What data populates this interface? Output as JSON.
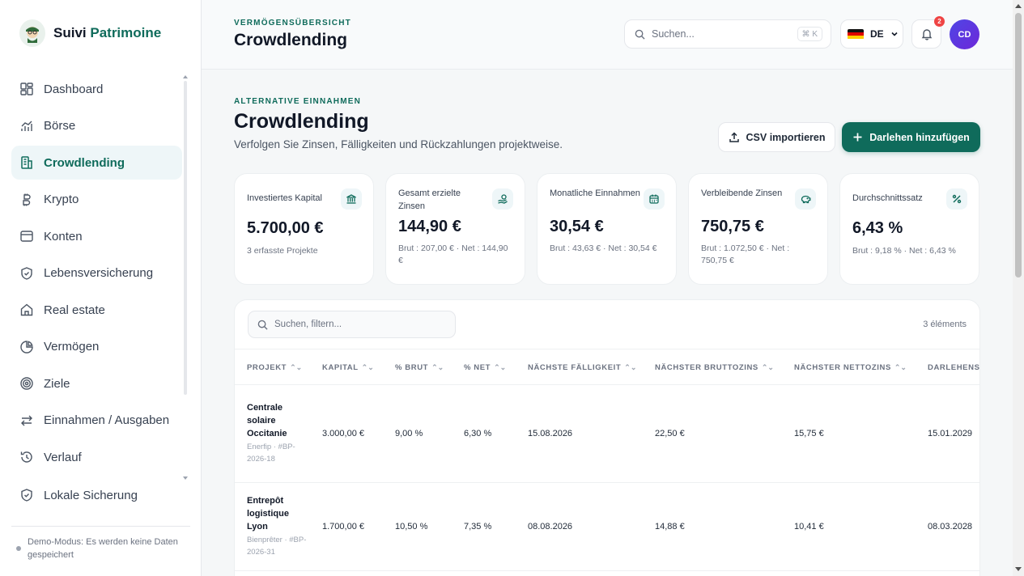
{
  "brand": {
    "name_a": "Suivi",
    "name_b": "Patrimoine"
  },
  "sidebar": {
    "items": [
      {
        "label": "Dashboard"
      },
      {
        "label": "Börse"
      },
      {
        "label": "Crowdlending"
      },
      {
        "label": "Krypto"
      },
      {
        "label": "Konten"
      },
      {
        "label": "Lebensversicherung"
      },
      {
        "label": "Real estate"
      },
      {
        "label": "Vermögen"
      },
      {
        "label": "Ziele"
      },
      {
        "label": "Einnahmen / Ausgaben"
      },
      {
        "label": "Verlauf"
      },
      {
        "label": "Lokale Sicherung"
      }
    ],
    "active": "Crowdlending",
    "demo_note": "Demo-Modus: Es werden keine Daten gespeichert"
  },
  "header": {
    "eyebrow": "VERMÖGENSÜBERSICHT",
    "title": "Crowdlending",
    "search_placeholder": "Suchen...",
    "shortcut": "⌘ K",
    "language": "DE",
    "notifications": "2",
    "avatar_initials": "CD"
  },
  "page": {
    "eyebrow": "ALTERNATIVE EINNAHMEN",
    "title": "Crowdlending",
    "subtitle": "Verfolgen Sie Zinsen, Fälligkeiten und Rückzahlungen projektweise.",
    "csv_button": "CSV importieren",
    "add_button": "Darlehen hinzufügen"
  },
  "kpis": [
    {
      "label": "Investiertes Kapital",
      "value": "5.700,00 €",
      "note": "3 erfasste Projekte",
      "icon": "bank-icon"
    },
    {
      "label": "Gesamt erzielte Zinsen",
      "value": "144,90 €",
      "note": "Brut : 207,00 € · Net : 144,90 €",
      "icon": "coins-hand-icon"
    },
    {
      "label": "Monatliche Einnahmen",
      "value": "30,54 €",
      "note": "Brut : 43,63 € · Net : 30,54 €",
      "icon": "calendar-icon"
    },
    {
      "label": "Verbleibende Zinsen",
      "value": "750,75 €",
      "note": "Brut : 1.072,50 € · Net : 750,75 €",
      "icon": "piggy-bank-icon"
    },
    {
      "label": "Durchschnittssatz",
      "value": "6,43 %",
      "note": "Brut : 9,18 % · Net : 6,43 %",
      "icon": "percent-icon"
    }
  ],
  "table": {
    "search_placeholder": "Suchen, filtern...",
    "count": "3 éléments",
    "columns": [
      "PROJEKT",
      "KAPITAL",
      "% BRUT",
      "% NET",
      "NÄCHSTE FÄLLIGKEIT",
      "NÄCHSTER BRUTTOZINS",
      "NÄCHSTER NETTOZINS",
      "DARLEHENSI"
    ],
    "sort_glyph": "⌃⌄",
    "rows": [
      {
        "name": "Centrale solaire Occitanie",
        "meta": "Enerfip · #BP-2026-18",
        "kapital": "3.000,00 €",
        "brut": "9,00 %",
        "net": "6,30 %",
        "faellig": "15.08.2026",
        "bzins": "22,50 €",
        "nzins": "15,75 €",
        "ende": "15.01.2029"
      },
      {
        "name": "Entrepôt logistique Lyon",
        "meta": "Bienprêter · #BP-2026-31",
        "kapital": "1.700,00 €",
        "brut": "10,50 %",
        "net": "7,35 %",
        "faellig": "08.08.2026",
        "bzins": "14,88 €",
        "nzins": "10,41 €",
        "ende": "08.03.2028"
      }
    ]
  },
  "colors": {
    "accent": "#0f6b5b",
    "active_bg": "#eef6f8",
    "badge": "#ef4444",
    "avatar": "#5b3fd6"
  }
}
